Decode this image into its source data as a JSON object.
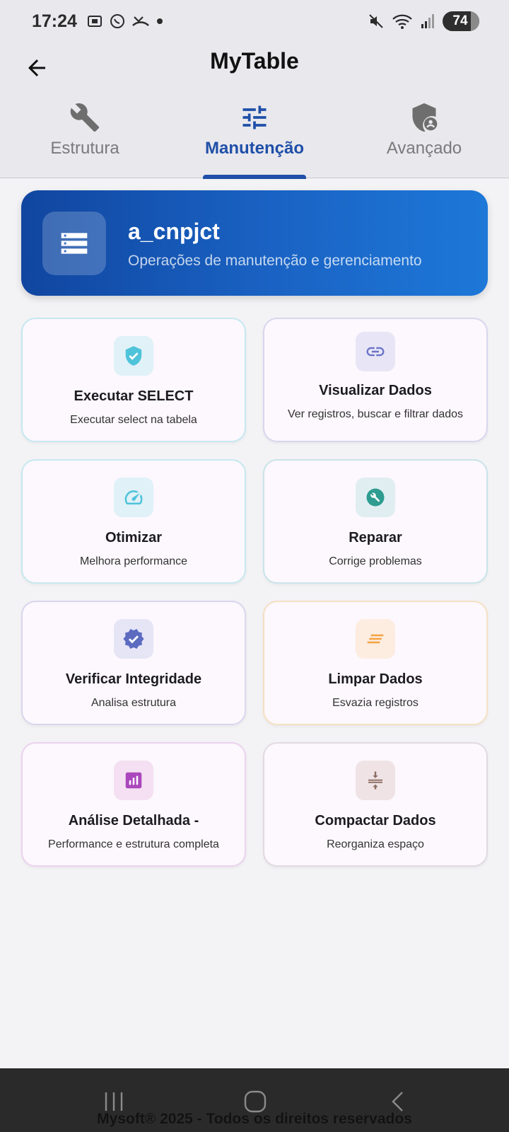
{
  "status_bar": {
    "time": "17:24",
    "battery": "74",
    "left_icons": [
      "screenshot-icon",
      "whatsapp-icon",
      "missed-call-icon",
      "dot-icon"
    ],
    "right_icons": [
      "mute-icon",
      "wifi-icon",
      "signal-icon",
      "battery-icon"
    ]
  },
  "app_bar": {
    "title": "MyTable"
  },
  "tabs": [
    {
      "label": "Estrutura",
      "icon": "wrench-icon",
      "active": false
    },
    {
      "label": "Manutenção",
      "icon": "tune-icon",
      "active": true
    },
    {
      "label": "Avançado",
      "icon": "admin-shield-icon",
      "active": false
    }
  ],
  "table_card": {
    "name": "a_cnpjct",
    "subtitle": "Operações de manutenção e gerenciamento"
  },
  "actions": [
    {
      "title": "Executar SELECT",
      "desc": "Executar select na tabela",
      "icon": "verified-shield-icon",
      "color": "#4fc3d9"
    },
    {
      "title": "Visualizar Dados",
      "desc": "Ver registros, buscar e filtrar dados",
      "icon": "link-icon",
      "color": "#6b73c8"
    },
    {
      "title": "Otimizar",
      "desc": "Melhora performance",
      "icon": "speed-icon",
      "color": "#4fc3d9"
    },
    {
      "title": "Reparar",
      "desc": "Corrige problemas",
      "icon": "build-circle-icon",
      "color": "#2e9c90"
    },
    {
      "title": "Verificar Integridade",
      "desc": "Analisa estrutura",
      "icon": "verified-badge-icon",
      "color": "#5c6bc0"
    },
    {
      "title": "Limpar Dados",
      "desc": "Esvazia registros",
      "icon": "clear-all-icon",
      "color": "#f4a340"
    },
    {
      "title": "Análise Detalhada -",
      "desc": "Performance e estrutura completa",
      "icon": "analytics-icon",
      "color": "#ab47bc"
    },
    {
      "title": "Compactar Dados",
      "desc": "Reorganiza espaço",
      "icon": "compress-icon",
      "color": "#8d6e63"
    }
  ],
  "footer": {
    "text": "Mysoft® 2025 - Todos os direitos reservados"
  }
}
